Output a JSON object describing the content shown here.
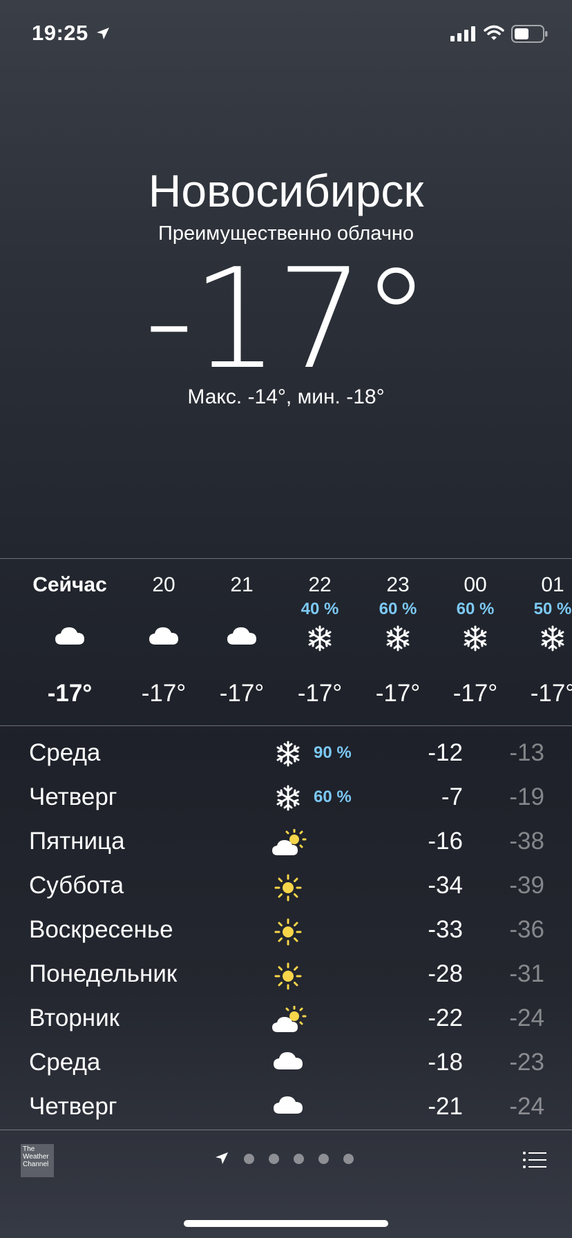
{
  "status": {
    "time": "19:25"
  },
  "header": {
    "city": "Новосибирск",
    "condition": "Преимущественно облачно",
    "temp": "-17°",
    "hilo": "Макс. -14°, мин. -18°"
  },
  "hourly": [
    {
      "label": "Сейчас",
      "pct": "",
      "icon": "cloud-icon",
      "temp": "-17°"
    },
    {
      "label": "20",
      "pct": "",
      "icon": "cloud-icon",
      "temp": "-17°"
    },
    {
      "label": "21",
      "pct": "",
      "icon": "cloud-icon",
      "temp": "-17°"
    },
    {
      "label": "22",
      "pct": "40 %",
      "icon": "snowflake-icon",
      "temp": "-17°"
    },
    {
      "label": "23",
      "pct": "60 %",
      "icon": "snowflake-icon",
      "temp": "-17°"
    },
    {
      "label": "00",
      "pct": "60 %",
      "icon": "snowflake-icon",
      "temp": "-17°"
    },
    {
      "label": "01",
      "pct": "50 %",
      "icon": "snowflake-icon",
      "temp": "-17°"
    }
  ],
  "daily": [
    {
      "name": "Среда",
      "icon": "snowflake-icon",
      "pct": "90 %",
      "max": "-12",
      "min": "-13"
    },
    {
      "name": "Четверг",
      "icon": "snowflake-icon",
      "pct": "60 %",
      "max": "-7",
      "min": "-19"
    },
    {
      "name": "Пятница",
      "icon": "partly-sunny-icon",
      "pct": "",
      "max": "-16",
      "min": "-38"
    },
    {
      "name": "Суббота",
      "icon": "sun-icon",
      "pct": "",
      "max": "-34",
      "min": "-39"
    },
    {
      "name": "Воскресенье",
      "icon": "sun-icon",
      "pct": "",
      "max": "-33",
      "min": "-36"
    },
    {
      "name": "Понедельник",
      "icon": "sun-icon",
      "pct": "",
      "max": "-28",
      "min": "-31"
    },
    {
      "name": "Вторник",
      "icon": "partly-sunny-icon",
      "pct": "",
      "max": "-22",
      "min": "-24"
    },
    {
      "name": "Среда",
      "icon": "cloud-icon",
      "pct": "",
      "max": "-18",
      "min": "-23"
    },
    {
      "name": "Четверг",
      "icon": "cloud-icon",
      "pct": "",
      "max": "-21",
      "min": "-24"
    }
  ],
  "footer": {
    "logo_lines": [
      "The",
      "Weather",
      "Channel"
    ],
    "page_count": 5
  },
  "colors": {
    "precip": "#7cc9f5",
    "sun": "#f7d54a"
  }
}
